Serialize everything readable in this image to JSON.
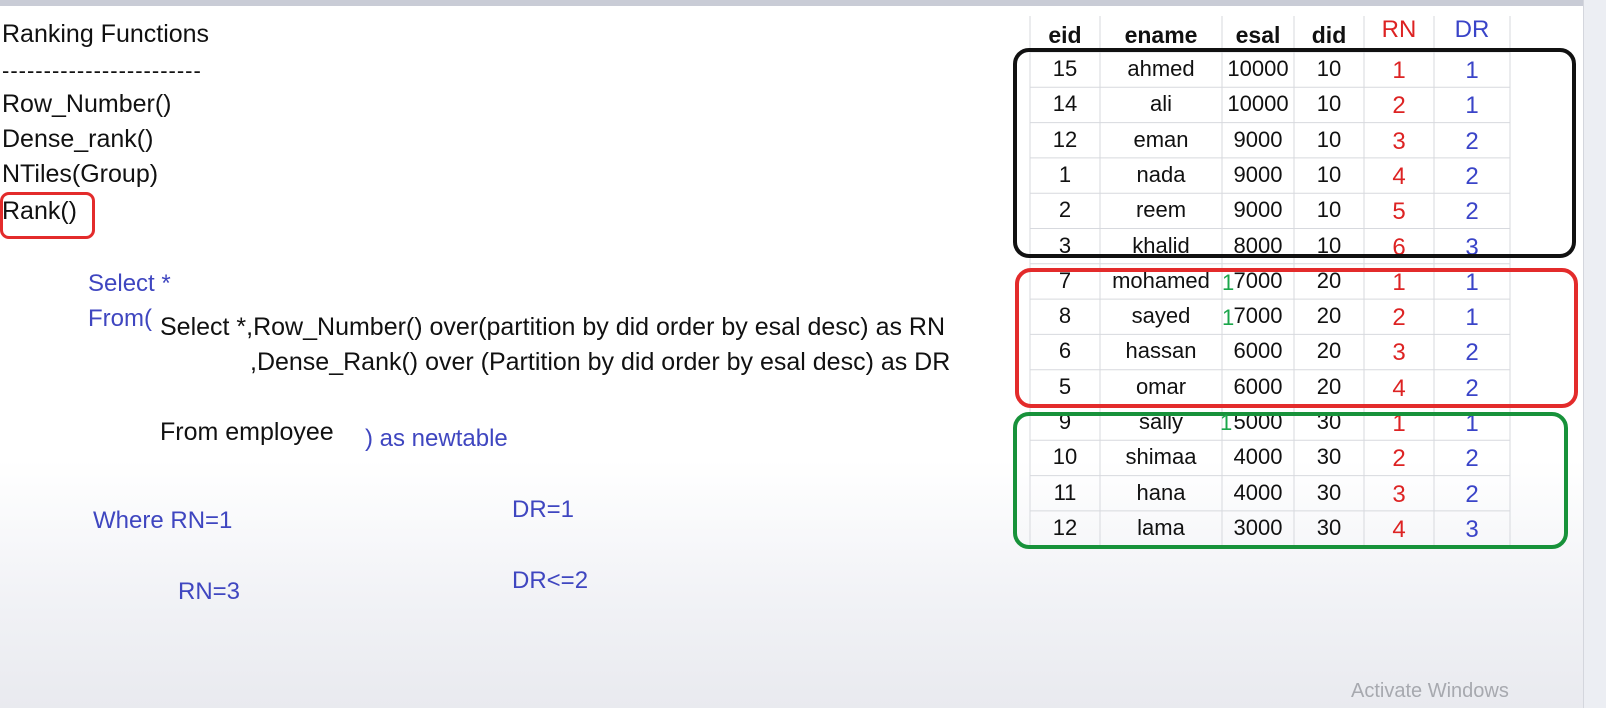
{
  "slide": {
    "title": "Ranking Functions",
    "separator": "------------------------",
    "functions": [
      "Row_Number()",
      "Dense_rank()",
      "NTiles(Group)",
      "Rank()"
    ],
    "query": {
      "select_outer": "Select *",
      "from_outer": "From(",
      "inner_line1": "Select *,Row_Number() over(partition by did order by esal desc) as RN",
      "inner_line2": ",Dense_Rank()   over (Partition by did order by esal desc) as DR",
      "inner_from": "From employee",
      "alias": ") as newtable",
      "where_rn1": "Where RN=1",
      "rn3": "RN=3",
      "dr1": "DR=1",
      "dr2": "DR<=2"
    }
  },
  "table": {
    "headers": [
      "eid",
      "ename",
      "esal",
      "did",
      "RN",
      "DR"
    ],
    "rows": [
      [
        "15",
        "ahmed",
        "10000",
        "10",
        "1",
        "1"
      ],
      [
        "14",
        "ali",
        "10000",
        "10",
        "2",
        "1"
      ],
      [
        "12",
        "eman",
        "9000",
        "10",
        "3",
        "2"
      ],
      [
        "1",
        "nada",
        "9000",
        "10",
        "4",
        "2"
      ],
      [
        "2",
        "reem",
        "9000",
        "10",
        "5",
        "2"
      ],
      [
        "3",
        "khalid",
        "8000",
        "10",
        "6",
        "3"
      ],
      [
        "7",
        "mohamed",
        "7000",
        "20",
        "1",
        "1"
      ],
      [
        "8",
        "sayed",
        "7000",
        "20",
        "2",
        "1"
      ],
      [
        "6",
        "hassan",
        "6000",
        "20",
        "3",
        "2"
      ],
      [
        "5",
        "omar",
        "6000",
        "20",
        "4",
        "2"
      ],
      [
        "9",
        "sally",
        "5000",
        "30",
        "1",
        "1"
      ],
      [
        "10",
        "shimaa",
        "4000",
        "30",
        "2",
        "2"
      ],
      [
        "11",
        "hana",
        "4000",
        "30",
        "3",
        "2"
      ],
      [
        "12",
        "lama",
        "3000",
        "30",
        "4",
        "3"
      ]
    ],
    "annotation_marks": [
      "1",
      "1",
      "1"
    ]
  },
  "watermark": "Activate Windows",
  "colors": {
    "red": "#e32b2b",
    "blue": "#3f46c0",
    "green": "#17923a",
    "black": "#111111"
  }
}
